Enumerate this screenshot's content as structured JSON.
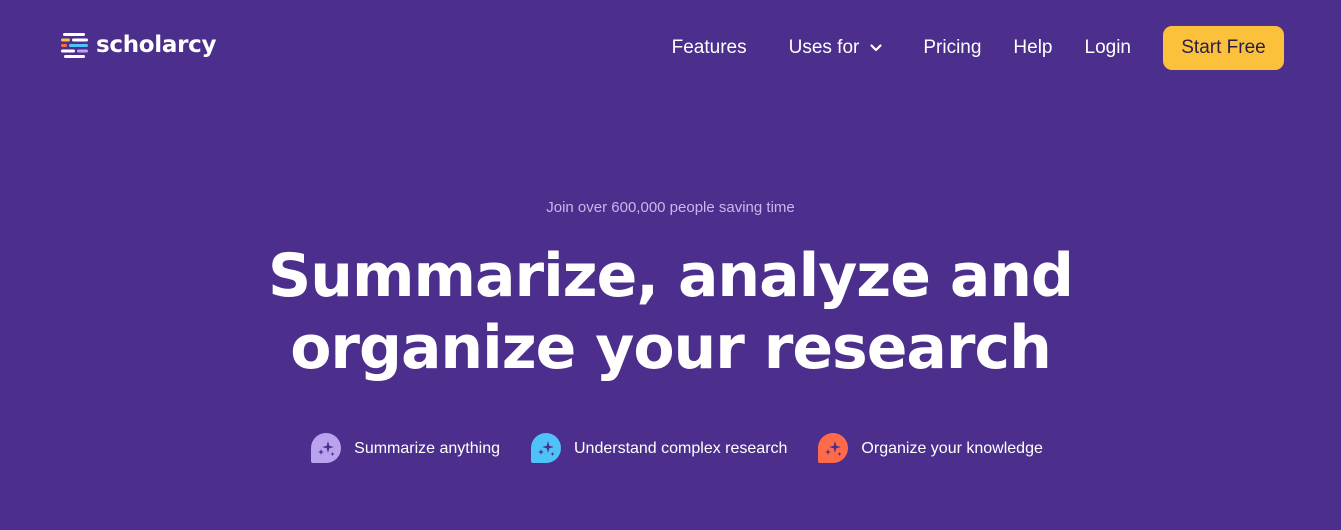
{
  "brand": {
    "name": "scholarcy",
    "logo_icon": "stacked-lines-logo-icon",
    "logo_colors": [
      "#ffffff",
      "#fbc13b",
      "#4fc3f7",
      "#ff6b4a",
      "#b9a3ee"
    ]
  },
  "nav": {
    "items": [
      {
        "label": "Features"
      },
      {
        "label": "Uses for",
        "icon": "chevron-down-icon"
      },
      {
        "label": "Pricing"
      },
      {
        "label": "Help"
      },
      {
        "label": "Login"
      }
    ],
    "cta_label": "Start Free"
  },
  "hero": {
    "eyebrow": "Join over 600,000 people saving time",
    "headline_line1": "Summarize, analyze and",
    "headline_line2": "organize your research",
    "features": [
      {
        "label": "Summarize anything",
        "icon": "sparkle-chat-icon",
        "color": "#b9a3ee"
      },
      {
        "label": "Understand complex research",
        "icon": "sparkle-chat-icon",
        "color": "#4fc3f7"
      },
      {
        "label": "Organize your knowledge",
        "icon": "sparkle-chat-icon",
        "color": "#ff6b4a"
      }
    ]
  },
  "colors": {
    "background": "#4c2f8c",
    "accent": "#fbc13b",
    "eyebrow_text": "#c7b7ec",
    "text": "#ffffff"
  }
}
